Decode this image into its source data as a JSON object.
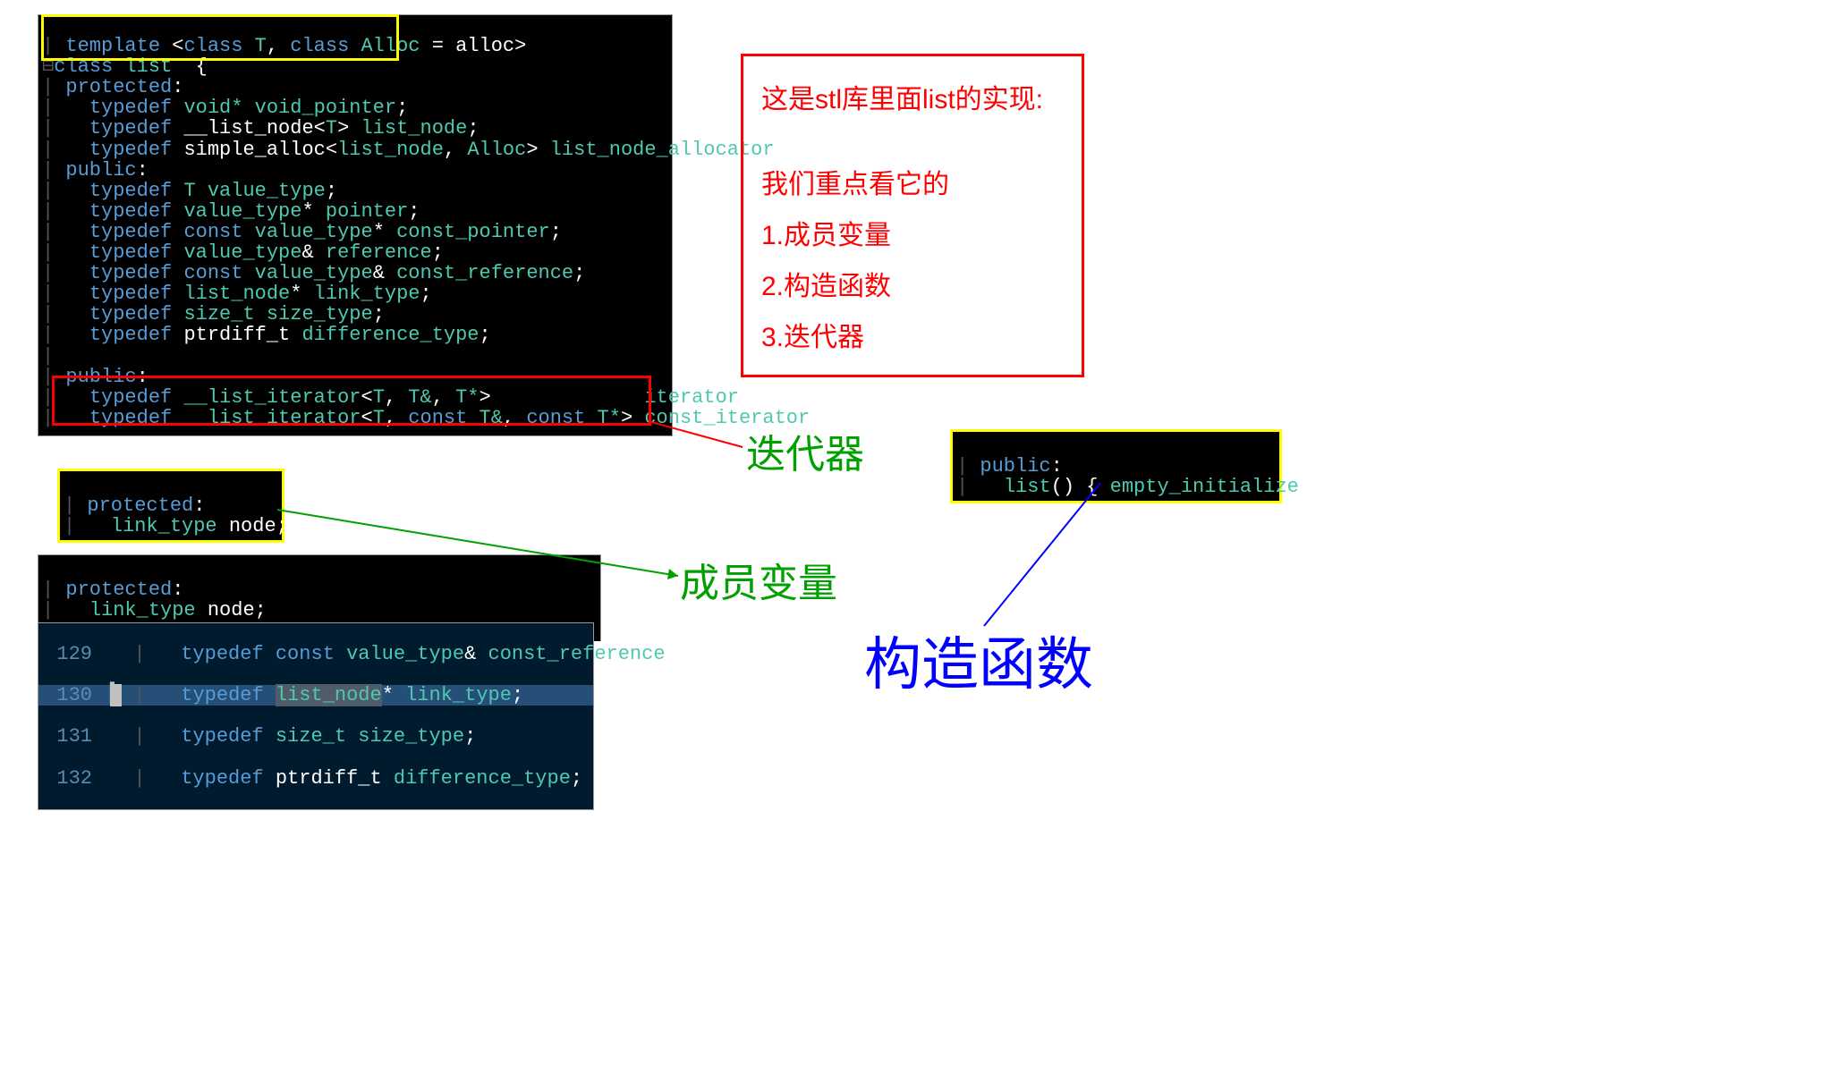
{
  "main_code": {
    "l1": {
      "template": "template",
      "lt": "<",
      "class1": "class",
      "T": "T",
      "comma": ", ",
      "class2": "class",
      "Alloc": "Alloc",
      "eq": " = ",
      "alloc": "alloc",
      "gt": ">"
    },
    "l2": {
      "fold": "⊟",
      "class": "class",
      "list": "list",
      "brace": "  {"
    },
    "l3": {
      "protected": "protected",
      "colon": ":"
    },
    "l4": {
      "typedef": "typedef",
      "voidp": "void*",
      "void_pointer": "void_pointer",
      ";": ";"
    },
    "l5": {
      "typedef": "typedef",
      "__list_node": "__list_node",
      "lt": "<",
      "T": "T",
      "gt": ">",
      "list_node": "list_node",
      ";": ";"
    },
    "l6": {
      "typedef": "typedef",
      "simple_alloc": "simple_alloc",
      "lt": "<",
      "list_node": "list_node",
      "comma": ", ",
      "Alloc": "Alloc",
      "gt": ">",
      "list_node_allocator": "list_node_allocator",
      ";": ";"
    },
    "l7": {
      "public": "public",
      "colon": ":"
    },
    "l8": {
      "typedef": "typedef",
      "T": "T",
      "value_type": "value_type",
      ";": ";"
    },
    "l9": {
      "typedef": "typedef",
      "value_type": "value_type",
      "star": "*",
      "pointer": "pointer",
      ";": ";"
    },
    "l10": {
      "typedef": "typedef",
      "const": "const",
      "value_type": "value_type",
      "star": "*",
      "const_pointer": "const_pointer",
      ";": ";"
    },
    "l11": {
      "typedef": "typedef",
      "value_type": "value_type",
      "amp": "&",
      "reference": "reference",
      ";": ";"
    },
    "l12": {
      "typedef": "typedef",
      "const": "const",
      "value_type": "value_type",
      "amp": "&",
      "const_reference": "const_reference",
      ";": ";"
    },
    "l13": {
      "typedef": "typedef",
      "list_node": "list_node",
      "star": "*",
      "link_type": "link_type",
      ";": ";"
    },
    "l14": {
      "typedef": "typedef",
      "size_t": "size_t",
      "size_type": "size_type",
      ";": ";"
    },
    "l15": {
      "typedef": "typedef",
      "ptrdiff_t": "ptrdiff_t",
      "difference_type": "difference_type",
      ";": ";"
    },
    "l17": {
      "public": "public",
      "colon": ":"
    },
    "l18": {
      "typedef": "typedef",
      "it": "__list_iterator",
      "lt": "<",
      "T": "T",
      "c1": ", ",
      "Tamp": "T&",
      "c2": ", ",
      "Tstar": "T*",
      "gt": ">",
      "sp": "             ",
      "iterator": "iterator",
      ";": ";"
    },
    "l19": {
      "typedef": "typedef",
      "it": "__list_iterator",
      "lt": "<",
      "T": "T",
      "c1": ", ",
      "const1": "const",
      "Tamp": "T&",
      "c2": ", ",
      "const2": "const",
      "Tstar": "T*",
      "gt": ">",
      "const_iterator": "const_iterator",
      ";": ";"
    }
  },
  "small_block1": {
    "l1": {
      "protected": "protected",
      "colon": ":"
    },
    "l2": {
      "link_type": "link_type",
      "node": "node",
      ";": ";"
    }
  },
  "small_block2": {
    "l1": {
      "protected": "protected",
      "colon": ":"
    },
    "l2": {
      "link_type": "link_type",
      "node": "node",
      ";": ";"
    }
  },
  "editor2": {
    "rows": [
      {
        "n": "129",
        "typedef": "typedef",
        "const": "const",
        "value_type": "value_type",
        "amp": "&",
        "const_reference": "const_reference",
        ";": ";"
      },
      {
        "n": "130",
        "typedef": "typedef",
        "list_node": "list_node",
        "star": "*",
        "link_type": "link_type",
        ";": ";"
      },
      {
        "n": "131",
        "typedef": "typedef",
        "size_t": "size_t",
        "size_type": "size_type",
        ";": ";"
      },
      {
        "n": "132",
        "typedef": "typedef",
        "ptrdiff_t": "ptrdiff_t",
        "difference_type": "difference_type",
        ";": ";"
      }
    ]
  },
  "right_small": {
    "l1": {
      "public": "public",
      "colon": ":"
    },
    "l2": {
      "list": "list",
      "paren": "()",
      "brace_o": " { ",
      "empty_initialize": "empty_initialize",
      "paren2": "()",
      "semi": "; ",
      "brace_c": "}"
    }
  },
  "note": {
    "t1": "这是stl库里面list的实现:",
    "t2": "我们重点看它的",
    "t3": "1.成员变量",
    "t4": "2.构造函数",
    "t5": "3.迭代器"
  },
  "labels": {
    "iterator": "迭代器",
    "member": "成员变量",
    "ctor": "构造函数"
  }
}
